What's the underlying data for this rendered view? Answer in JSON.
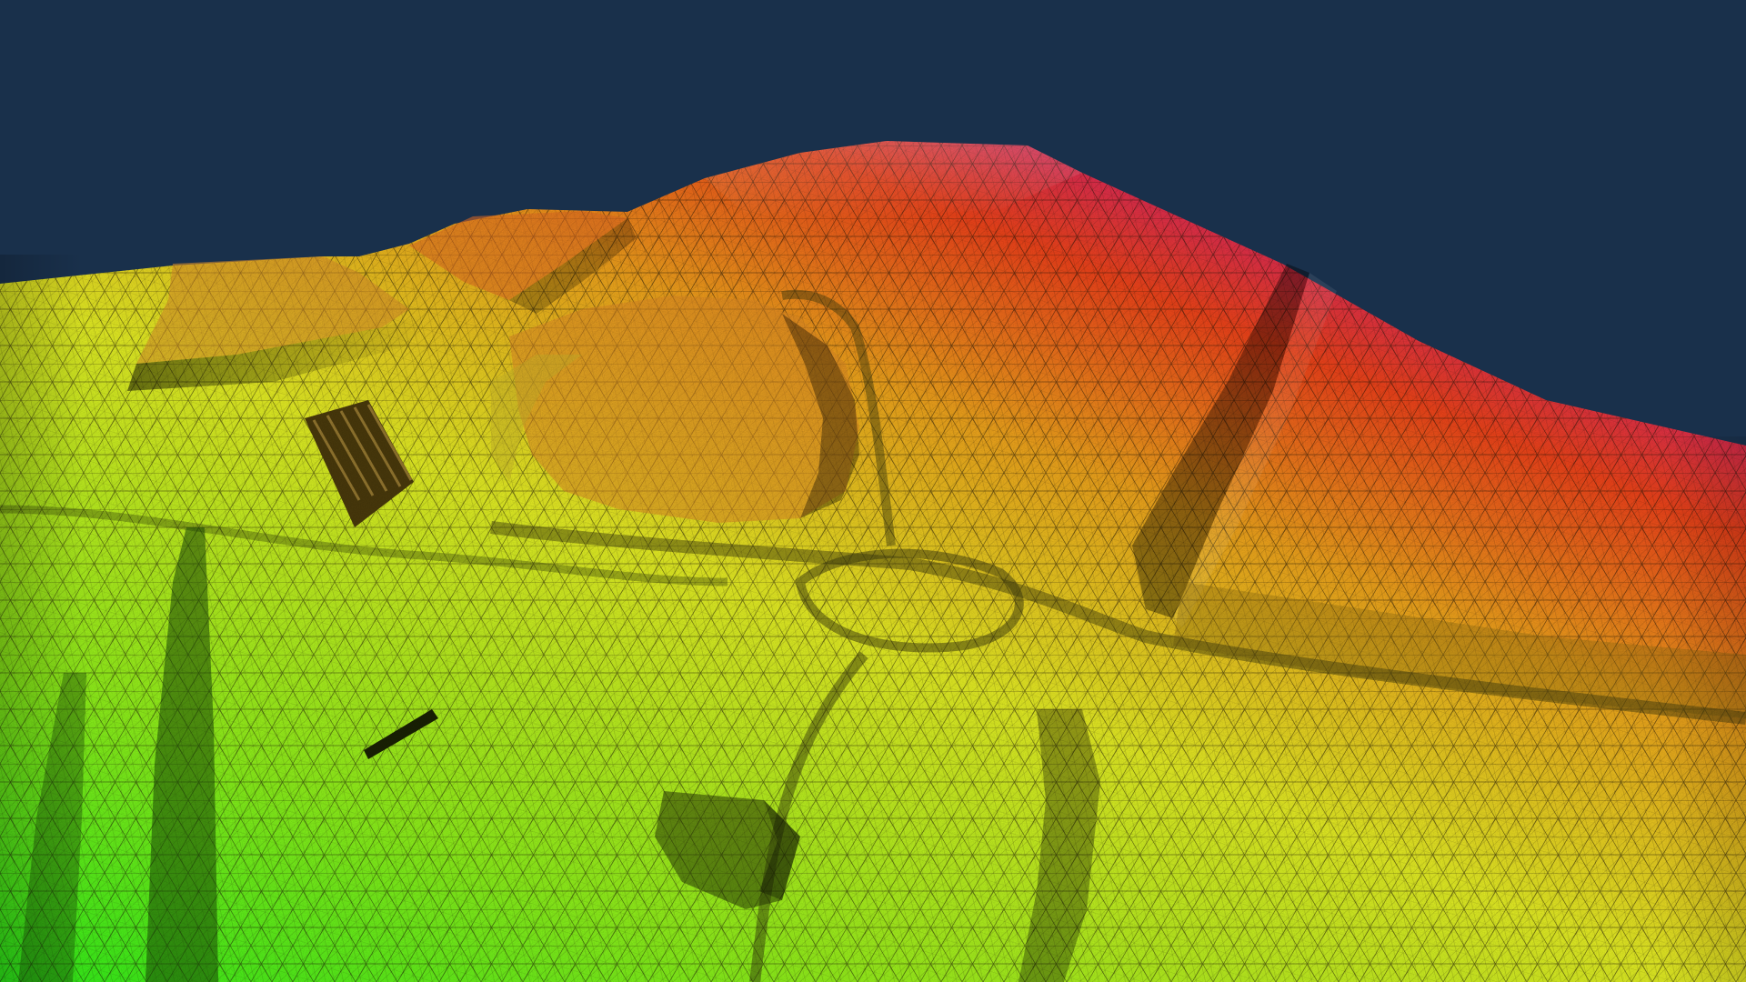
{
  "scene": {
    "sky_color": "#19304b",
    "colormap": [
      "#2ef21a",
      "#8ff21a",
      "#e6ef24",
      "#f0a51c",
      "#f0441a",
      "#d51a7a",
      "#c81ad8"
    ],
    "mesh_line_color": "#1a1208"
  }
}
